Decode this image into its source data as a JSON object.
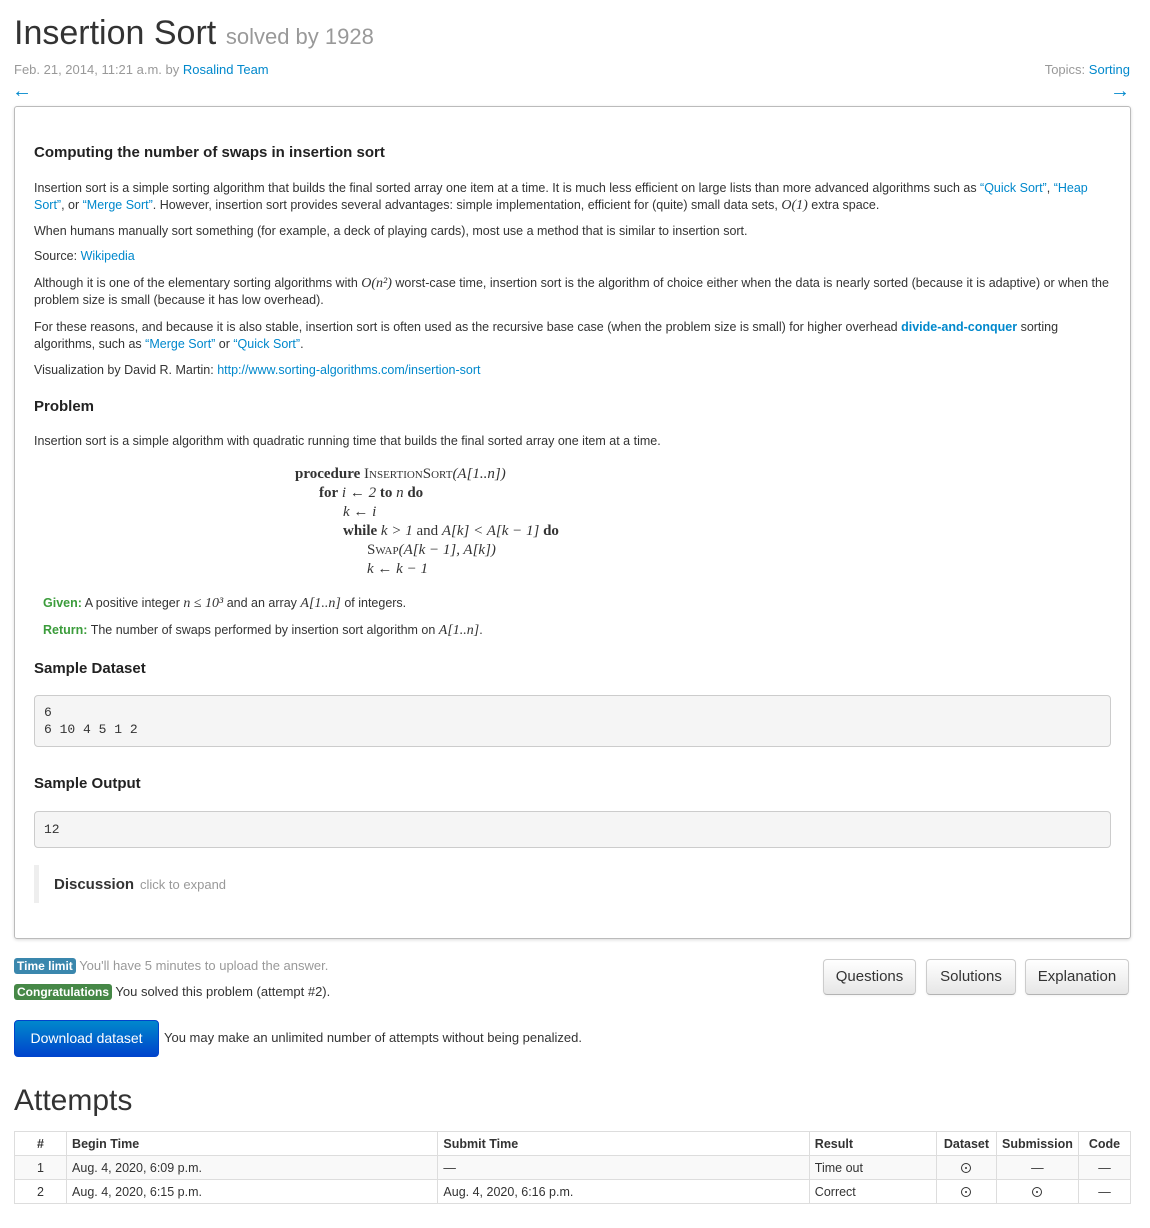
{
  "header": {
    "title": "Insertion Sort",
    "solved_by": "solved by 1928",
    "date_by": "Feb. 21, 2014, 11:21 a.m. by",
    "author": "Rosalind Team",
    "topics_label": "Topics:",
    "topic": "Sorting",
    "prev_arrow": "←",
    "next_arrow": "→"
  },
  "problem": {
    "heading": "Computing the number of swaps in insertion sort",
    "para1_a": "Insertion sort is a simple sorting algorithm that builds the final sorted array one item at a time. It is much less efficient on large lists than more advanced algorithms such as ",
    "link_quick_sort": "“Quick Sort”",
    "para1_comma": ",",
    "link_heap_sort": "“Heap Sort”",
    "para1_or": ", or ",
    "link_merge_sort": "“Merge Sort”",
    "para1_b": ". However, insertion sort provides several advantages: simple implementation, efficient for (quite) small data sets, ",
    "para1_math": "O(1)",
    "para1_c": " extra space.",
    "para2": "When humans manually sort something (for example, a deck of playing cards), most use a method that is similar to insertion sort.",
    "source_label": "Source: ",
    "source_link": "Wikipedia",
    "para3_a": "Although it is one of the elementary sorting algorithms with ",
    "para3_math": "O(n²)",
    "para3_b": " worst-case time, insertion sort is the algorithm of choice either when the data is nearly sorted (because it is adaptive) or when the problem size is small (because it has low overhead).",
    "para4_a": "For these reasons, and because it is also stable, insertion sort is often used as the recursive base case (when the problem size is small) for higher overhead ",
    "para4_link": "divide-and-conquer",
    "para4_b": " sorting algorithms, such as ",
    "para4_merge": "“Merge Sort”",
    "para4_or": " or ",
    "para4_quick": "“Quick Sort”",
    "para4_end": ".",
    "viz_label": "Visualization by David R. Martin: ",
    "viz_link": "http://www.sorting-algorithms.com/insertion-sort",
    "problem_heading": "Problem",
    "problem_text": "Insertion sort is a simple algorithm with quadratic running time that builds the final sorted array one item at a time.",
    "pseudocode": {
      "l1_kw": "procedure",
      "l1_name": "InsertionSort",
      "l1_args": "(A[1..n])",
      "l2_for": "for",
      "l2_var": "i ← 2",
      "l2_to": "to",
      "l2_n": "n",
      "l2_do": "do",
      "l3": "k ← i",
      "l4_while": "while",
      "l4_cond1": "k > 1",
      "l4_and": "and",
      "l4_cond2": "A[k] < A[k − 1]",
      "l4_do": "do",
      "l5_name": "Swap",
      "l5_args": "(A[k − 1], A[k])",
      "l6": "k ← k − 1"
    },
    "given_label": "Given:",
    "given_a": " A positive integer ",
    "given_math1": "n ≤ 10³",
    "given_b": " and an array ",
    "given_math2": "A[1..n]",
    "given_c": " of integers.",
    "return_label": "Return:",
    "return_a": " The number of swaps performed by insertion sort algorithm on ",
    "return_math": "A[1..n]",
    "return_b": ".",
    "sample_dataset_heading": "Sample Dataset",
    "sample_dataset": "6\n6 10 4 5 1 2",
    "sample_output_heading": "Sample Output",
    "sample_output": "12",
    "discussion_title": "Discussion",
    "discussion_hint": "click to expand"
  },
  "status": {
    "time_limit_badge": "Time limit",
    "time_limit_text": "You'll have 5 minutes to upload the answer.",
    "congrats_badge": "Congratulations",
    "congrats_text": "You solved this problem (attempt #2).",
    "download_button": "Download dataset",
    "unlimited_text": "You may make an unlimited number of attempts without being penalized."
  },
  "buttons": {
    "questions": "Questions",
    "solutions": "Solutions",
    "explanation": "Explanation"
  },
  "colors": {
    "link": "#0088cc",
    "given_green": "#3b9c3b",
    "badge_info": "#3a87ad",
    "badge_success": "#468847",
    "primary_button": "#0055cc"
  },
  "attempts": {
    "title": "Attempts",
    "columns": [
      "#",
      "Begin Time",
      "Submit Time",
      "Result",
      "Dataset",
      "Submission",
      "Code"
    ],
    "rows": [
      {
        "num": "1",
        "begin": "Aug. 4, 2020, 6:09 p.m.",
        "submit": "—",
        "result": "Time out",
        "submission": "—",
        "code": "—"
      },
      {
        "num": "2",
        "begin": "Aug. 4, 2020, 6:15 p.m.",
        "submit": "Aug. 4, 2020, 6:16 p.m.",
        "result": "Correct",
        "code": "—"
      }
    ],
    "dataset_icon": "download-circle-icon"
  }
}
